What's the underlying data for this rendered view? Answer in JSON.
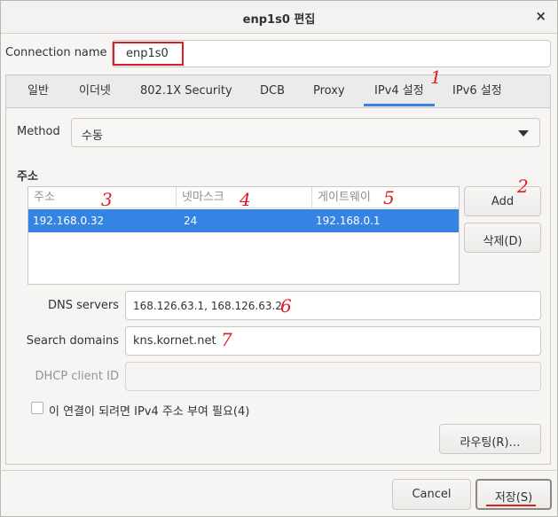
{
  "window": {
    "title": "enp1s0 편집",
    "close_symbol": "×"
  },
  "connection": {
    "label": "Connection name",
    "value": "enp1s0"
  },
  "tabs": [
    {
      "label": "일반"
    },
    {
      "label": "이더넷"
    },
    {
      "label": "802.1X Security"
    },
    {
      "label": "DCB"
    },
    {
      "label": "Proxy"
    },
    {
      "label": "IPv4 설정",
      "active": true
    },
    {
      "label": "IPv6 설정"
    }
  ],
  "method": {
    "label": "Method",
    "value": "수동"
  },
  "address": {
    "section_title": "주소",
    "columns": [
      "주소",
      "넷마스크",
      "게이트웨이"
    ],
    "rows": [
      {
        "address": "192.168.0.32",
        "netmask": "24",
        "gateway": "192.168.0.1"
      }
    ],
    "add_label": "Add",
    "delete_label": "삭제(D)"
  },
  "dns": {
    "label": "DNS servers",
    "value": "168.126.63.1, 168.126.63.2"
  },
  "search": {
    "label": "Search domains",
    "value": "kns.kornet.net"
  },
  "dhcp": {
    "label": "DHCP client ID",
    "value": ""
  },
  "require_ipv4": {
    "label": "이 연결이 되려면 IPv4 주소 부여 필요(4)",
    "checked": false
  },
  "routing_label": "라우팅(R)…",
  "footer": {
    "cancel_label": "Cancel",
    "save_label": "저장(S)"
  },
  "annotations": [
    "1",
    "2",
    "3",
    "4",
    "5",
    "6",
    "7"
  ],
  "colors": {
    "selection": "#3584e4",
    "annotation": "#e01b24"
  }
}
